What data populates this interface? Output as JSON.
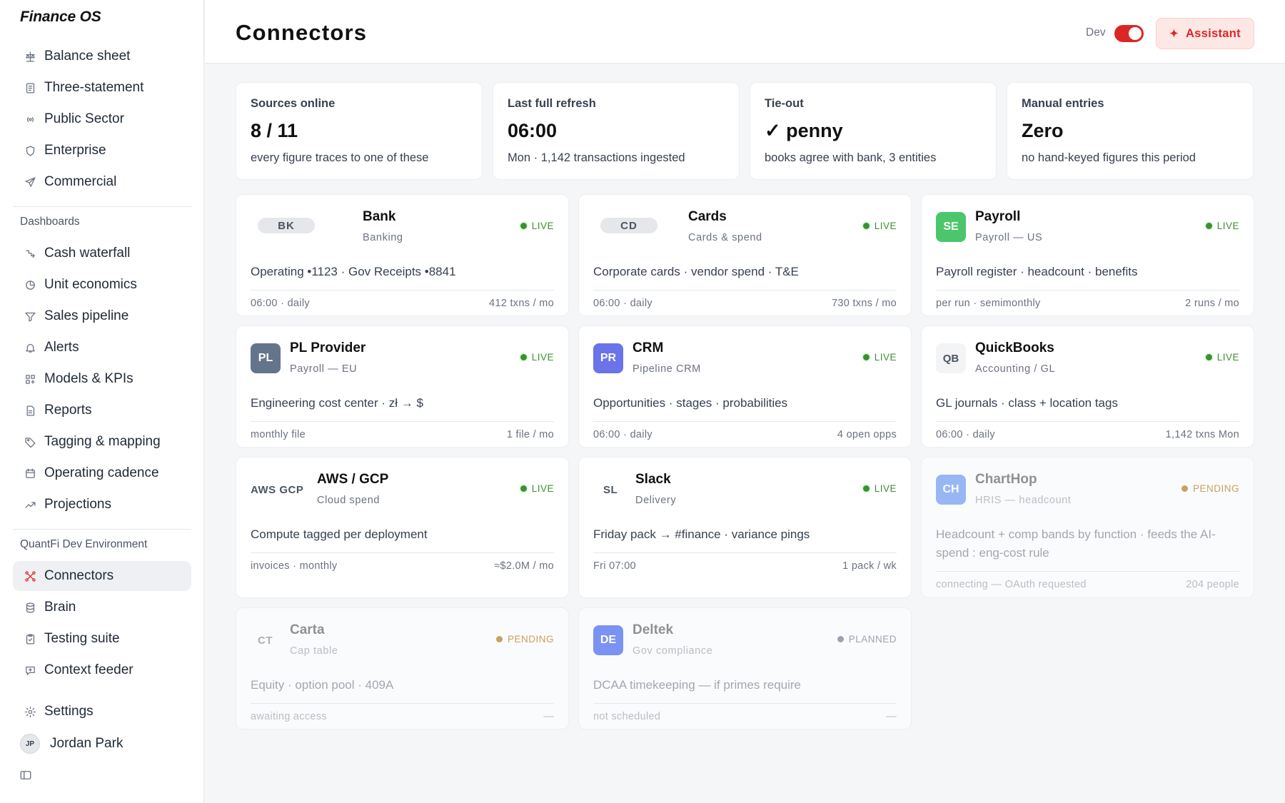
{
  "app": {
    "title": "Finance OS"
  },
  "sidebar": {
    "primary": [
      {
        "label": "Balance sheet",
        "icon": "scale-icon"
      },
      {
        "label": "Three-statement",
        "icon": "document-icon"
      },
      {
        "label": "Public Sector",
        "icon": "broadcast-icon"
      },
      {
        "label": "Enterprise",
        "icon": "shield-icon"
      },
      {
        "label": "Commercial",
        "icon": "send-icon"
      }
    ],
    "dashboards_label": "Dashboards",
    "dashboards": [
      {
        "label": "Cash waterfall",
        "icon": "waterfall-icon"
      },
      {
        "label": "Unit economics",
        "icon": "pie-icon"
      },
      {
        "label": "Sales pipeline",
        "icon": "filter-icon"
      },
      {
        "label": "Alerts",
        "icon": "bell-icon"
      },
      {
        "label": "Models & KPIs",
        "icon": "grid-icon"
      },
      {
        "label": "Reports",
        "icon": "report-icon"
      },
      {
        "label": "Tagging & mapping",
        "icon": "tag-icon"
      },
      {
        "label": "Operating cadence",
        "icon": "calendar-icon"
      },
      {
        "label": "Projections",
        "icon": "trend-icon"
      }
    ],
    "dev_env_label": "QuantFi Dev Environment",
    "dev_env": [
      {
        "label": "Connectors",
        "icon": "connectors-icon",
        "active": true
      },
      {
        "label": "Brain",
        "icon": "database-icon"
      },
      {
        "label": "Testing suite",
        "icon": "clipboard-check-icon"
      },
      {
        "label": "Context feeder",
        "icon": "message-plus-icon"
      }
    ],
    "settings_label": "Settings",
    "user": {
      "initials": "JP",
      "name": "Jordan Park"
    }
  },
  "header": {
    "title": "Connectors",
    "dev_label": "Dev",
    "dev_toggle_on": true,
    "assistant_label": "Assistant",
    "assistant_icon": "✦",
    "accent": "#dc2626"
  },
  "stats": [
    {
      "label": "Sources online",
      "value": "8 / 11",
      "sub": "every figure traces to one of these"
    },
    {
      "label": "Last full refresh",
      "value": "06:00",
      "sub": "Mon · 1,142 transactions ingested"
    },
    {
      "label": "Tie-out",
      "value": "✓ penny",
      "sub": "books agree with bank, 3 entities"
    },
    {
      "label": "Manual entries",
      "value": "Zero",
      "sub": "no hand-keyed figures this period"
    }
  ],
  "connectors": [
    {
      "logo": "BK",
      "name": "Bank",
      "category": "Banking",
      "status": "LIVE",
      "desc": "Operating •1123 · Gov Receipts •8841",
      "foot_left": "06:00 · daily",
      "foot_right": "412 txns / mo"
    },
    {
      "logo": "CD",
      "name": "Cards",
      "category": "Cards & spend",
      "status": "LIVE",
      "desc": "Corporate cards · vendor spend · T&E",
      "foot_left": "06:00 · daily",
      "foot_right": "730 txns / mo"
    },
    {
      "logo": "SE",
      "name": "Payroll",
      "category": "Payroll — US",
      "status": "LIVE",
      "desc": "Payroll register · headcount · benefits",
      "foot_left": "per run · semimonthly",
      "foot_right": "2 runs / mo",
      "logo_color": "#4cc66a"
    },
    {
      "logo": "PL",
      "name": "PL Provider",
      "category": "Payroll — EU",
      "status": "LIVE",
      "desc": "Engineering cost center · zł → $",
      "foot_left": "monthly file",
      "foot_right": "1 file / mo",
      "logo_color": "#64748b"
    },
    {
      "logo": "PR",
      "name": "CRM",
      "category": "Pipeline CRM",
      "status": "LIVE",
      "desc": "Opportunities · stages · probabilities",
      "foot_left": "06:00 · daily",
      "foot_right": "4 open opps",
      "logo_color": "#6b73e8"
    },
    {
      "logo": "QB",
      "name": "QuickBooks",
      "category": "Accounting / GL",
      "status": "LIVE",
      "desc": "GL journals · class + location tags",
      "foot_left": "06:00 · daily",
      "foot_right": "1,142 txns Mon"
    },
    {
      "logo": "AWS GCP",
      "name": "AWS / GCP",
      "category": "Cloud spend",
      "status": "LIVE",
      "desc": "Compute tagged per deployment",
      "foot_left": "invoices · monthly",
      "foot_right": "≈$2.0M / mo"
    },
    {
      "logo": "SL",
      "name": "Slack",
      "category": "Delivery",
      "status": "LIVE",
      "desc": "Friday pack → #finance · variance pings",
      "foot_left": "Fri 07:00",
      "foot_right": "1 pack / wk"
    },
    {
      "logo": "CH",
      "name": "ChartHop",
      "category": "HRIS — headcount",
      "status": "PENDING",
      "desc": "Headcount + comp bands by function · feeds the AI-spend : eng-cost rule",
      "foot_left": "connecting — OAuth requested",
      "foot_right": "204 people",
      "logo_color": "#2563eb"
    },
    {
      "logo": "CT",
      "name": "Carta",
      "category": "Cap table",
      "status": "PENDING",
      "desc": "Equity · option pool · 409A",
      "foot_left": "awaiting access",
      "foot_right": "—"
    },
    {
      "logo": "DE",
      "name": "Deltek",
      "category": "Gov compliance",
      "status": "PLANNED",
      "desc": "DCAA timekeeping — if primes require",
      "foot_left": "not scheduled",
      "foot_right": "—",
      "logo_color": "#5b78f0"
    }
  ],
  "colors": {
    "live": "#3f8f30",
    "pending": "#c9a064",
    "planned": "#9ca3af",
    "active_nav_bg": "#eef0f4"
  }
}
